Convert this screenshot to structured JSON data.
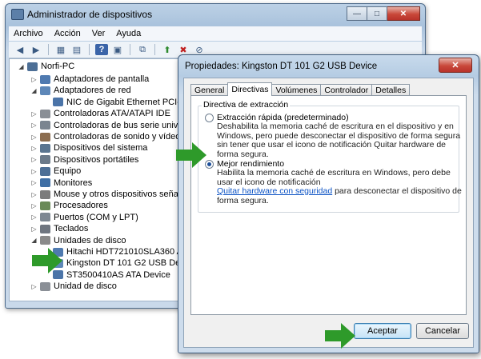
{
  "device_manager": {
    "title": "Administrador de dispositivos",
    "window_buttons": {
      "minimize": "—",
      "maximize": "□",
      "close": "✕"
    },
    "menu": [
      "Archivo",
      "Acción",
      "Ver",
      "Ayuda"
    ],
    "toolbar_icons": [
      "back-arrow-icon",
      "forward-arrow-icon",
      "view-icon",
      "view-list-icon",
      "help-icon",
      "properties-icon",
      "update-driver-icon",
      "scan-hardware-icon",
      "uninstall-icon",
      "disable-icon"
    ],
    "tree": {
      "root": "Norfi-PC",
      "items": [
        {
          "label": "Adaptadores de pantalla",
          "expanded": false
        },
        {
          "label": "Adaptadores de red",
          "expanded": true
        },
        {
          "label": "NIC de Gigabit Ethernet PCI-E de",
          "child": true
        },
        {
          "label": "Controladoras ATA/ATAPI IDE",
          "expanded": false
        },
        {
          "label": "Controladoras de bus serie universal",
          "expanded": false
        },
        {
          "label": "Controladoras de sonido y vídeo y d",
          "expanded": false
        },
        {
          "label": "Dispositivos del sistema",
          "expanded": false
        },
        {
          "label": "Dispositivos portátiles",
          "expanded": false
        },
        {
          "label": "Equipo",
          "expanded": false
        },
        {
          "label": "Monitores",
          "expanded": false
        },
        {
          "label": "Mouse y otros dispositivos señalador",
          "expanded": false
        },
        {
          "label": "Procesadores",
          "expanded": false
        },
        {
          "label": "Puertos (COM y LPT)",
          "expanded": false
        },
        {
          "label": "Teclados",
          "expanded": false
        },
        {
          "label": "Unidades de disco",
          "expanded": true
        },
        {
          "label": "Hitachi HDT721010SLA360 ATA De",
          "child": true
        },
        {
          "label": "Kingston DT 101 G2 USB Device",
          "child": true
        },
        {
          "label": "ST3500410AS ATA Device",
          "child": true
        },
        {
          "label": "Unidad de disco",
          "expanded": false
        }
      ]
    }
  },
  "properties_dialog": {
    "title": "Propiedades: Kingston DT 101 G2 USB Device",
    "close_label": "✕",
    "tabs": [
      "General",
      "Directivas",
      "Volúmenes",
      "Controlador",
      "Detalles"
    ],
    "active_tab": "Directivas",
    "group_title": "Directiva de extracción",
    "option_quick": {
      "label": "Extracción rápida (predeterminado)",
      "selected": false,
      "description": "Deshabilita la memoria caché de escritura en el dispositivo y en Windows, pero puede desconectar el dispositivo de forma segura sin tener que usar el icono de notificación Quitar hardware de forma segura."
    },
    "option_performance": {
      "label": "Mejor rendimiento",
      "selected": true,
      "description": "Habilita la memoria caché de escritura en Windows, pero debe usar el icono de notificación",
      "link": "Quitar hardware con seguridad",
      "description_tail": "para desconectar el dispositivo de forma segura."
    },
    "ok_label": "Aceptar",
    "cancel_label": "Cancelar"
  },
  "colors": {
    "arrow": "#2e9a2a",
    "link": "#0b52c4"
  }
}
